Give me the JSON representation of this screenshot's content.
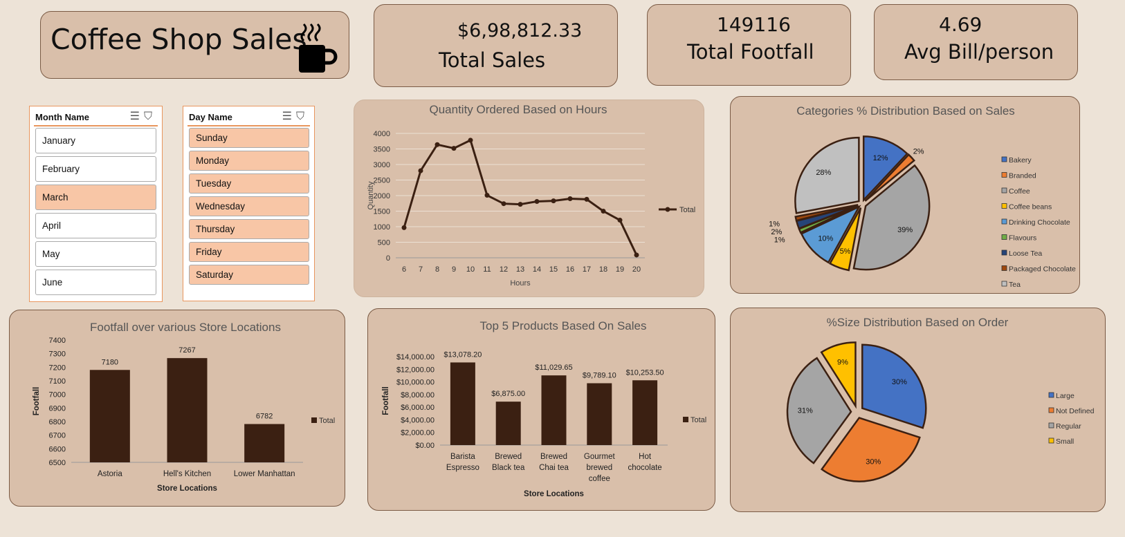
{
  "title": {
    "text": "Coffee Shop Sales",
    "icon": "coffee-cup-icon"
  },
  "kpis": {
    "total_sales": {
      "value": "$6,98,812.33",
      "label": "Total Sales"
    },
    "total_footfall": {
      "value": "149116",
      "label": "Total  Footfall"
    },
    "avg_bill": {
      "value": "4.69",
      "label": "Avg Bill/person"
    }
  },
  "slicers": {
    "month": {
      "header": "Month Name",
      "items": [
        {
          "label": "January",
          "selected": false
        },
        {
          "label": "February",
          "selected": false
        },
        {
          "label": "March",
          "selected": true
        },
        {
          "label": "April",
          "selected": false
        },
        {
          "label": "May",
          "selected": false
        },
        {
          "label": "June",
          "selected": false
        }
      ]
    },
    "day": {
      "header": "Day Name",
      "items": [
        {
          "label": "Sunday",
          "selected": true
        },
        {
          "label": "Monday",
          "selected": true
        },
        {
          "label": "Tuesday",
          "selected": true
        },
        {
          "label": "Wednesday",
          "selected": true
        },
        {
          "label": "Thursday",
          "selected": true
        },
        {
          "label": "Friday",
          "selected": true
        },
        {
          "label": "Saturday",
          "selected": true
        }
      ]
    }
  },
  "colors": {
    "dark": "#3b2012",
    "card": "#d9bfaa",
    "bg": "#ede3d7",
    "slicer_selected": "#f8c6a6",
    "slicer_border": "#e8955c"
  },
  "chart_data": [
    {
      "id": "hours",
      "type": "line",
      "title": "Quantity Ordered Based on Hours",
      "xlabel": "Hours",
      "ylabel": "Quantity",
      "x": [
        6,
        7,
        8,
        9,
        10,
        11,
        12,
        13,
        14,
        15,
        16,
        17,
        18,
        19,
        20
      ],
      "series": [
        {
          "name": "Total",
          "values": [
            970,
            2800,
            3640,
            3520,
            3780,
            2010,
            1740,
            1720,
            1810,
            1830,
            1900,
            1880,
            1500,
            1210,
            90
          ]
        }
      ],
      "ylim": [
        0,
        4000
      ],
      "yticks": [
        0,
        500,
        1000,
        1500,
        2000,
        2500,
        3000,
        3500,
        4000
      ],
      "grid": true,
      "legend": "right"
    },
    {
      "id": "categories",
      "type": "pie",
      "title": "Categories % Distribution Based on Sales",
      "slices": [
        {
          "name": "Bakery",
          "value": 12,
          "label": "12%",
          "color": "#4472c4"
        },
        {
          "name": "Branded",
          "value": 2,
          "label": "2%",
          "color": "#ed7d31"
        },
        {
          "name": "Coffee",
          "value": 39,
          "label": "39%",
          "color": "#a5a5a5"
        },
        {
          "name": "Coffee beans",
          "value": 5,
          "label": "5%",
          "color": "#ffc000"
        },
        {
          "name": "Drinking Chocolate",
          "value": 10,
          "label": "10%",
          "color": "#5b9bd5"
        },
        {
          "name": "Flavours",
          "value": 1,
          "label": "1%",
          "color": "#70ad47"
        },
        {
          "name": "Loose Tea",
          "value": 2,
          "label": "2%",
          "color": "#264478"
        },
        {
          "name": "Packaged Chocolate",
          "value": 1,
          "label": "1%",
          "color": "#9e480e"
        },
        {
          "name": "Tea",
          "value": 28,
          "label": "28%",
          "color": "#c0c0c0"
        }
      ],
      "legend": "right"
    },
    {
      "id": "footfall",
      "type": "bar",
      "title": "Footfall over various Store Locations",
      "xlabel": "Store Locations",
      "ylabel": "Footfall",
      "categories": [
        "Astoria",
        "Hell's Kitchen",
        "Lower Manhattan"
      ],
      "series": [
        {
          "name": "Total",
          "values": [
            7180,
            7267,
            6782
          ]
        }
      ],
      "data_labels": [
        "7180",
        "7267",
        "6782"
      ],
      "ylim": [
        6500,
        7400
      ],
      "yticks": [
        6500,
        6600,
        6700,
        6800,
        6900,
        7000,
        7100,
        7200,
        7300,
        7400
      ],
      "legend": "right"
    },
    {
      "id": "products",
      "type": "bar",
      "title": "Top 5 Products Based On Sales",
      "xlabel": "Store Locations",
      "ylabel": "Footfall",
      "categories": [
        "Barista Espresso",
        "Brewed Black tea",
        "Brewed Chai tea",
        "Gourmet brewed coffee",
        "Hot chocolate"
      ],
      "category_lines": [
        [
          "Barista",
          "Espresso"
        ],
        [
          "Brewed",
          "Black tea"
        ],
        [
          "Brewed",
          "Chai tea"
        ],
        [
          "Gourmet",
          "brewed",
          "coffee"
        ],
        [
          "Hot",
          "chocolate"
        ]
      ],
      "series": [
        {
          "name": "Total",
          "values": [
            13078.2,
            6875.0,
            11029.65,
            9789.1,
            10253.5
          ]
        }
      ],
      "data_labels": [
        "$13,078.20",
        "$6,875.00",
        "$11,029.65",
        "$9,789.10",
        "$10,253.50"
      ],
      "ylim": [
        0,
        14000
      ],
      "yticks": [
        0,
        2000,
        4000,
        6000,
        8000,
        10000,
        12000,
        14000
      ],
      "ytick_labels": [
        "$0.00",
        "$2,000.00",
        "$4,000.00",
        "$6,000.00",
        "$8,000.00",
        "$10,000.00",
        "$12,000.00",
        "$14,000.00"
      ],
      "legend": "right"
    },
    {
      "id": "sizes",
      "type": "pie",
      "title": "%Size Distribution Based on Order",
      "slices": [
        {
          "name": "Large",
          "value": 30,
          "label": "30%",
          "color": "#4472c4"
        },
        {
          "name": "Not Defined",
          "value": 30,
          "label": "30%",
          "color": "#ed7d31"
        },
        {
          "name": "Regular",
          "value": 31,
          "label": "31%",
          "color": "#a5a5a5"
        },
        {
          "name": "Small",
          "value": 9,
          "label": "9%",
          "color": "#ffc000"
        }
      ],
      "legend": "right"
    }
  ]
}
